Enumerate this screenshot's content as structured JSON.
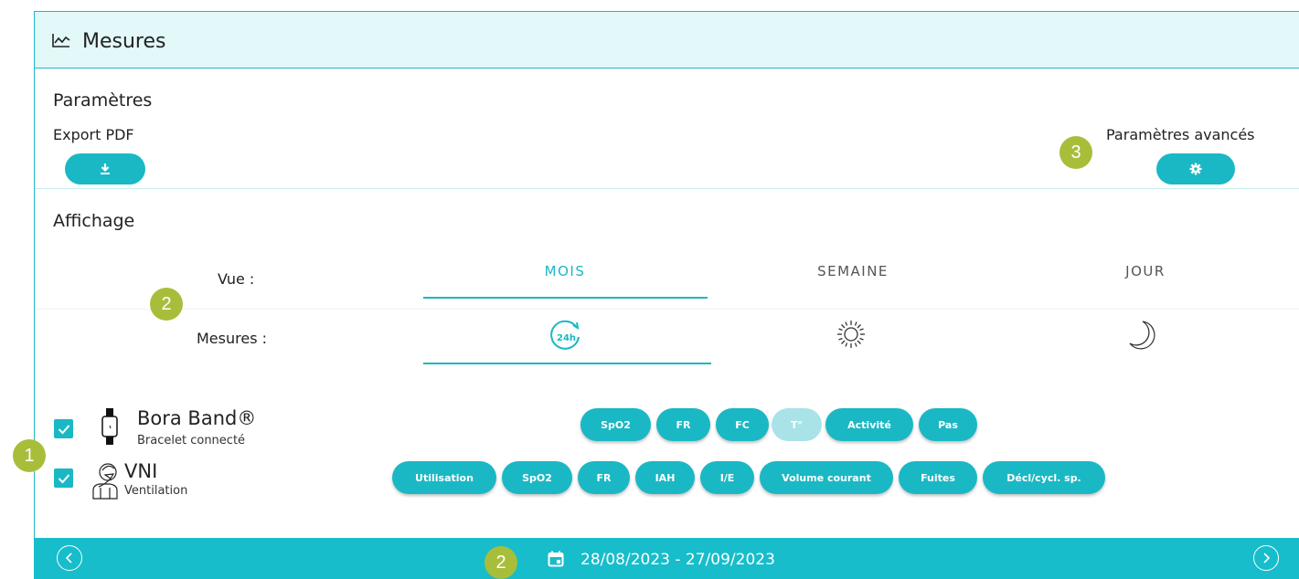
{
  "header": {
    "title": "Mesures",
    "icon": "line-chart-icon"
  },
  "parametres": {
    "title": "Paramètres",
    "export_label": "Export PDF",
    "export_icon": "download-icon",
    "advanced_label": "Paramètres avancés",
    "advanced_icon": "gear-icon"
  },
  "affichage": {
    "title": "Affichage",
    "vue_label": "Vue :",
    "mesures_label": "Mesures :",
    "tabs": [
      {
        "label": "MOIS",
        "active": true
      },
      {
        "label": "SEMAINE",
        "active": false
      },
      {
        "label": "JOUR",
        "active": false
      }
    ],
    "measure_icons": [
      "24h-icon",
      "sun-icon",
      "moon-icon"
    ]
  },
  "devices": [
    {
      "name": "Bora Band®",
      "subtitle": "Bracelet connecté",
      "checked": true,
      "icon": "watch-icon",
      "chips": [
        {
          "label": "SpO2",
          "enabled": true
        },
        {
          "label": "FR",
          "enabled": true
        },
        {
          "label": "FC",
          "enabled": true
        },
        {
          "label": "T°",
          "enabled": false
        },
        {
          "label": "Activité",
          "enabled": true
        },
        {
          "label": "Pas",
          "enabled": true
        }
      ]
    },
    {
      "name": "VNI",
      "subtitle": "Ventilation",
      "checked": true,
      "icon": "ventilation-icon",
      "chips": [
        {
          "label": "Utilisation",
          "enabled": true
        },
        {
          "label": "SpO2",
          "enabled": true
        },
        {
          "label": "FR",
          "enabled": true
        },
        {
          "label": "IAH",
          "enabled": true
        },
        {
          "label": "I/E",
          "enabled": true
        },
        {
          "label": "Volume courant",
          "enabled": true
        },
        {
          "label": "Fuites",
          "enabled": true
        },
        {
          "label": "Décl/cycl. sp.",
          "enabled": true
        }
      ]
    }
  ],
  "annotations": [
    "1",
    "2",
    "2",
    "3"
  ],
  "footer": {
    "date_range": "28/08/2023 - 27/09/2023",
    "calendar_icon": "calendar-icon",
    "prev_icon": "chevron-left-icon",
    "next_icon": "chevron-right-icon"
  },
  "colors": {
    "accent": "#1ab8c4",
    "header_bg": "#e3f8f9",
    "badge": "#a8be3a",
    "disabled_chip": "#a9e3e8"
  }
}
